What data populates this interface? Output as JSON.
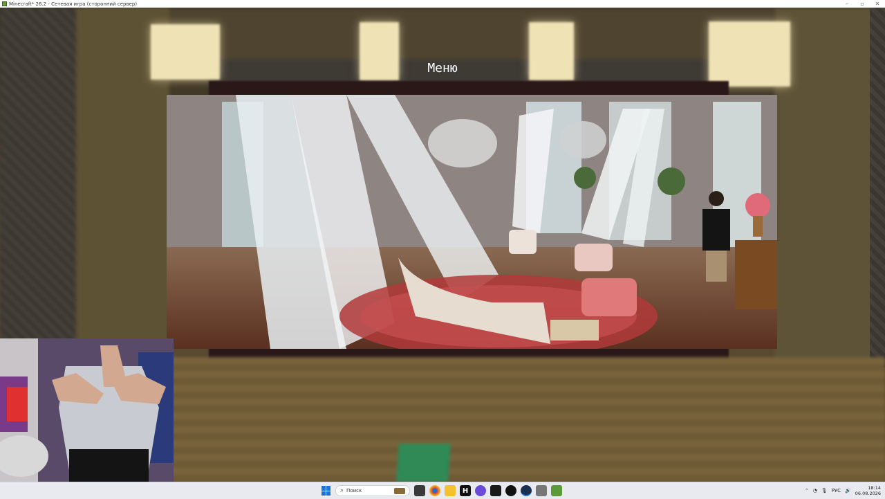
{
  "window": {
    "title": "Minecraft* 26.2 - Сетевая игра (сторонний сервер)",
    "controls": {
      "minimize": "–",
      "maximize": "▫",
      "close": "✕"
    }
  },
  "game": {
    "menu_title": "Меню",
    "block_color": "#2f8a55"
  },
  "taskbar": {
    "search_placeholder": "Поиск",
    "pinned_icons": [
      "windows-start-icon",
      "search-icon",
      "task-view-icon",
      "chrome-icon",
      "file-explorer-icon",
      "hbo-icon",
      "messenger-icon",
      "terminal-icon",
      "github-icon",
      "steam-icon",
      "app-icon",
      "minecraft-icon"
    ],
    "tray": {
      "language": "РУС",
      "time": "18:14",
      "date": "06.08.2026"
    }
  },
  "colors": {
    "taskbar_bg": "#e9eaf0",
    "accent": "#1a73d9"
  }
}
